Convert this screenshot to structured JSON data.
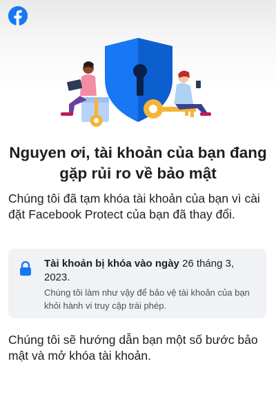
{
  "header": {
    "logo_icon": "facebook-logo-icon"
  },
  "hero": {
    "illustration": "security-shield-keyhole-illustration"
  },
  "title": "Nguyen ơi, tài khoản của bạn đang gặp rủi ro về bảo mật",
  "description": "Chúng tôi đã tạm khóa tài khoản của bạn vì cài đặt Facebook Protect của bạn đã thay đổi.",
  "notice": {
    "icon": "lock-icon",
    "locked_label": "Tài khoản bị khóa vào ngày",
    "locked_date": " 26 tháng 3, 2023.",
    "detail": "Chúng tôi làm như vậy để bảo vệ tài khoản của bạn khỏi hành vi truy cập trái phép."
  },
  "guide": "Chúng tôi sẽ hướng dẫn bạn một số bước bảo mật và mở khóa tài khoản.",
  "colors": {
    "brand": "#1877f2",
    "notice_bg": "#f0f2f5",
    "text": "#1c1e21"
  }
}
